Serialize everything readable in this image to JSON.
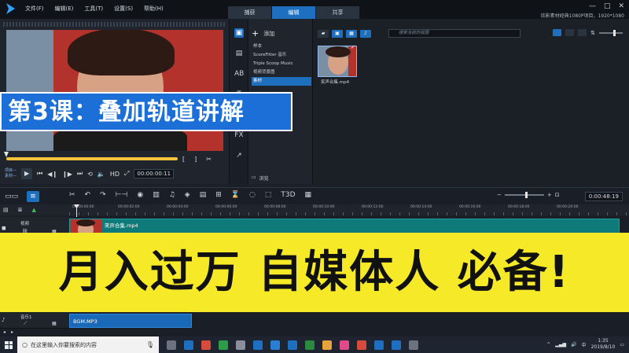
{
  "titlebar": {
    "menu": [
      "文件(F)",
      "编辑(E)",
      "工具(T)",
      "设置(S)",
      "帮助(H)"
    ],
    "tabs": [
      "捕获",
      "编辑",
      "共享"
    ],
    "active_tab": "编辑",
    "project_info": "炫影素材经典1080P项目，1920*1080",
    "win_min": "—",
    "win_max": "□",
    "win_close": "✕"
  },
  "player": {
    "mode_project": "项目—",
    "mode_clip": "素材—",
    "timecode": "00:00:00:11",
    "bracket_in": "[",
    "bracket_out": "]"
  },
  "library": {
    "add_label": "添加",
    "folders": [
      "样本",
      "ScoreFitter 音乐",
      "Triple Scoop Music",
      "视频背景图",
      "素材"
    ],
    "selected_folder_index": 4,
    "browse_label": "浏览",
    "search_placeholder": "搜索当前的视图",
    "thumbnail_name": "笑声合集.mp4"
  },
  "timeline": {
    "timecode": "0:00:48:19",
    "ruler_labels": [
      "00:00:00:00",
      "00:00:02:00",
      "00:00:04:00",
      "00:00:06:00",
      "00:00:08:00",
      "00:00:10:00",
      "00:00:12:00",
      "00:00:14:00",
      "00:00:16:00",
      "00:00:18:00",
      "00:00:20:00"
    ],
    "video_track_label": "视频",
    "video_clip_name": "笑声合集.mp4",
    "audio_track_label": "音乐1",
    "audio_clip_name": "BGM.MP3"
  },
  "overlays": {
    "lesson_title": "第3课：叠加轨道讲解",
    "promo_text": "月入过万 自媒体人 必备!"
  },
  "taskbar": {
    "search_placeholder": "在这里输入你要搜索的内容",
    "time": "1:35",
    "date": "2019/8/10",
    "input_method": "中",
    "app_colors": [
      "#6b7280",
      "#1e6fbf",
      "#d64b3c",
      "#2c9c4a",
      "#8a8f99",
      "#1e6fbf",
      "#2a7fd4",
      "#1e6fbf",
      "#2b8a3e",
      "#e6a23c",
      "#e04a8a",
      "#d64b3c",
      "#1e6fbf",
      "#1e6fbf",
      "#6b7280"
    ]
  },
  "colors": {
    "accent": "#1f6fbf",
    "banner_bg": "#1c6fd6",
    "promo_bg": "#f6e927",
    "video_clip": "#0f7a7a",
    "audio_clip": "#1a68b8",
    "scrub": "#f5c23c"
  }
}
